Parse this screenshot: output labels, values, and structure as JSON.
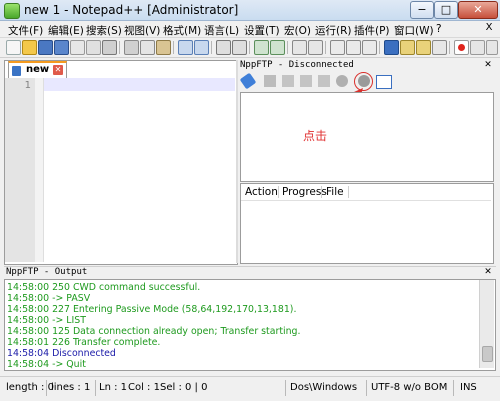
{
  "window": {
    "title": "new  1 - Notepad++ [Administrator]",
    "minimize_glyph": "−",
    "maximize_glyph": "□",
    "close_glyph": "✕"
  },
  "menu": {
    "items": [
      "文件(F)",
      "编辑(E)",
      "搜索(S)",
      "视图(V)",
      "格式(M)",
      "语言(L)",
      "设置(T)",
      "宏(O)",
      "运行(R)",
      "插件(P)",
      "窗口(W)",
      "?"
    ],
    "right_close": "X"
  },
  "toolbar": {
    "icons": [
      "new-file-icon",
      "open-file-icon",
      "save-icon",
      "save-all-icon",
      "close-icon",
      "close-all-icon",
      "print-icon",
      "cut-icon",
      "copy-icon",
      "paste-icon",
      "undo-icon",
      "redo-icon",
      "find-icon",
      "replace-icon",
      "zoom-in-icon",
      "zoom-out-icon",
      "sync-vertical-icon",
      "sync-horizontal-icon",
      "word-wrap-icon",
      "show-all-chars-icon",
      "indent-guide-icon",
      "user-language-icon",
      "doc-map-icon",
      "function-list-icon",
      "folder-as-workspace-icon",
      "record-macro-icon",
      "stop-record-icon",
      "play-macro-icon",
      "run-macro-icon",
      "save-macro-icon"
    ]
  },
  "editor": {
    "tab_label": "new",
    "tab_close": "✕",
    "line_number": "1"
  },
  "nppftp": {
    "title": "NppFTP - Disconnected",
    "close": "✕",
    "annotation": "点击",
    "queue_columns": [
      "Action",
      "Progress",
      "File"
    ],
    "accent": "#d9302c"
  },
  "output": {
    "title": "NppFTP - Output",
    "close": "✕",
    "lines": [
      {
        "text": "14:58:00   250 CWD command successful.",
        "color": "#1e9a1e"
      },
      {
        "text": "14:58:00   -> PASV",
        "color": "#1e9a1e"
      },
      {
        "text": "14:58:00   227 Entering Passive Mode (58,64,192,170,13,181).",
        "color": "#1e9a1e"
      },
      {
        "text": "14:58:00   -> LIST",
        "color": "#1e9a1e"
      },
      {
        "text": "14:58:00   125 Data connection already open; Transfer starting.",
        "color": "#1e9a1e"
      },
      {
        "text": "14:58:01   226 Transfer complete.",
        "color": "#1e9a1e"
      },
      {
        "text": "14:58:04   Disconnected",
        "color": "#1a1aa8"
      },
      {
        "text": "14:58:04   -> Quit",
        "color": "#1e9a1e"
      }
    ]
  },
  "status": {
    "length": "length : 0",
    "lines": "lines : 1",
    "ln": "Ln : 1",
    "col": "Col : 1",
    "sel": "Sel : 0 | 0",
    "eol": "Dos\\Windows",
    "encoding": "UTF-8 w/o BOM",
    "mode": "INS"
  }
}
